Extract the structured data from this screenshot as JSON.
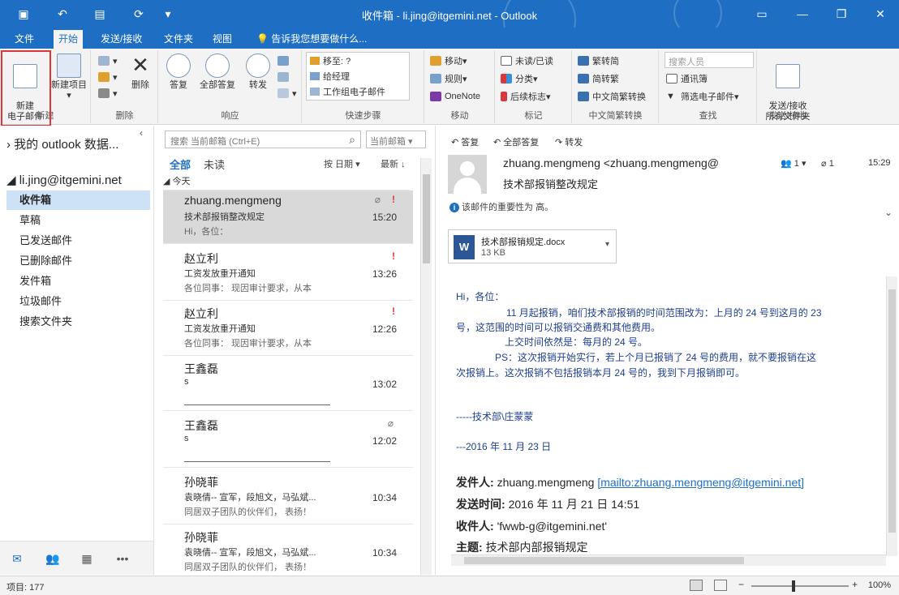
{
  "window": {
    "title": "收件箱 - li.jing@itgemini.net - Outlook"
  },
  "tabs": [
    "文件",
    "开始",
    "发送/接收",
    "文件夹",
    "视图"
  ],
  "tell_me": "告诉我您想要做什么...",
  "ribbon": {
    "new_mail": "新建\n电子邮件",
    "new_items": "新建项目",
    "delete": "删除",
    "reply": "答复",
    "reply_all": "全部答复",
    "forward": "转发",
    "quick_steps": [
      "移至: ?",
      "给经理",
      "工作组电子邮件"
    ],
    "move": "移动",
    "rules": "规则",
    "onenote": "OneNote",
    "unread_read": "未读/已读",
    "categorize": "分类",
    "follow_up": "后续标志",
    "trad_simp": "繁转简",
    "simp_trad": "简转繁",
    "chinese_conv": "中文简繁转换",
    "search_people": "搜索人员",
    "address_book": "通讯簿",
    "filter_email": "筛选电子邮件",
    "send_receive_all": "发送/接收\n所有文件夹",
    "groups": [
      "新建",
      "删除",
      "响应",
      "快速步骤",
      "移动",
      "标记",
      "中文简繁转换",
      "查找",
      "发送/接收"
    ]
  },
  "folders": {
    "favorites": "我的 outlook 数据...",
    "account": "li.jing@itgemini.net",
    "items": [
      "收件箱",
      "草稿",
      "已发送邮件",
      "已删除邮件",
      "发件箱",
      "垃圾邮件",
      "搜索文件夹"
    ]
  },
  "list": {
    "search_placeholder": "搜索 当前邮箱 (Ctrl+E)",
    "scope": "当前邮箱",
    "filter_all": "全部",
    "filter_unread": "未读",
    "sort_by": "按 日期",
    "sort_order": "最新",
    "group_header": "今天",
    "messages": [
      {
        "from": "zhuang.mengmeng",
        "subject": "技术部报销整改规定",
        "preview": "Hi，各位：",
        "time": "15:20"
      },
      {
        "from": "赵立利",
        "subject": "工资发放重开通知",
        "preview": "各位同事：  现因审计要求，从本",
        "time": "13:26"
      },
      {
        "from": "赵立利",
        "subject": "工资发放重开通知",
        "preview": "各位同事：  现因审计要求，从本",
        "time": "12:26"
      },
      {
        "from": "王鑫磊",
        "subject": "s",
        "preview": "",
        "time": "13:02"
      },
      {
        "from": "王鑫磊",
        "subject": "s",
        "preview": "",
        "time": "12:02"
      },
      {
        "from": "孙晓菲",
        "subject": "袁晓倩-- 宣军，段旭文，马弘斌...",
        "preview": "同居双子团队的伙伴们，  表扬！",
        "time": "10:34"
      },
      {
        "from": "孙晓菲",
        "subject": "袁晓倩-- 宣军，段旭文，马弘斌...",
        "preview": "同居双子团队的伙伴们，  表扬！",
        "time": "10:34"
      }
    ]
  },
  "reading": {
    "reply": "答复",
    "reply_all": "全部答复",
    "forward": "转发",
    "sender": "zhuang.mengmeng <zhuang.mengmeng@",
    "people_count": "1",
    "attach_count": "1",
    "time_short": "15:29",
    "subject": "技术部报销整改规定",
    "importance": "该邮件的重要性为 高。",
    "attachment_name": "技术部报销规定.docx",
    "attachment_size": "13 KB",
    "body": [
      "Hi，各位：",
      "11 月起报销，咱们技术部报销的时间范围改为：上月的 24 号到这月的 23",
      "号，这范围的时间可以报销交通费和其他费用。",
      "上交时间依然是：每月的 24 号。",
      "PS：这次报销开始实行，若上个月已报销了 24 号的费用，就不要报销在这",
      "次报销上。这次报销不包括报销本月 24 号的，我到下月报销即可。",
      "-----技术部\\庄蒙蒙",
      "---2016 年 11 月 23 日"
    ],
    "from_label": "发件人:",
    "from_value": "zhuang.mengmeng",
    "from_link": "[mailto:zhuang.mengmeng@itgemini.net]",
    "sent_label": "发送时间:",
    "sent_value": "2016 年 11 月 21 日 14:51",
    "to_label": "收件人:",
    "to_value": "'fwwb-g@itgemini.net'",
    "subj_label": "主题:",
    "subj_value": "技术部内部报销规定"
  },
  "status": {
    "items": "项目: 177",
    "zoom": "100%"
  }
}
